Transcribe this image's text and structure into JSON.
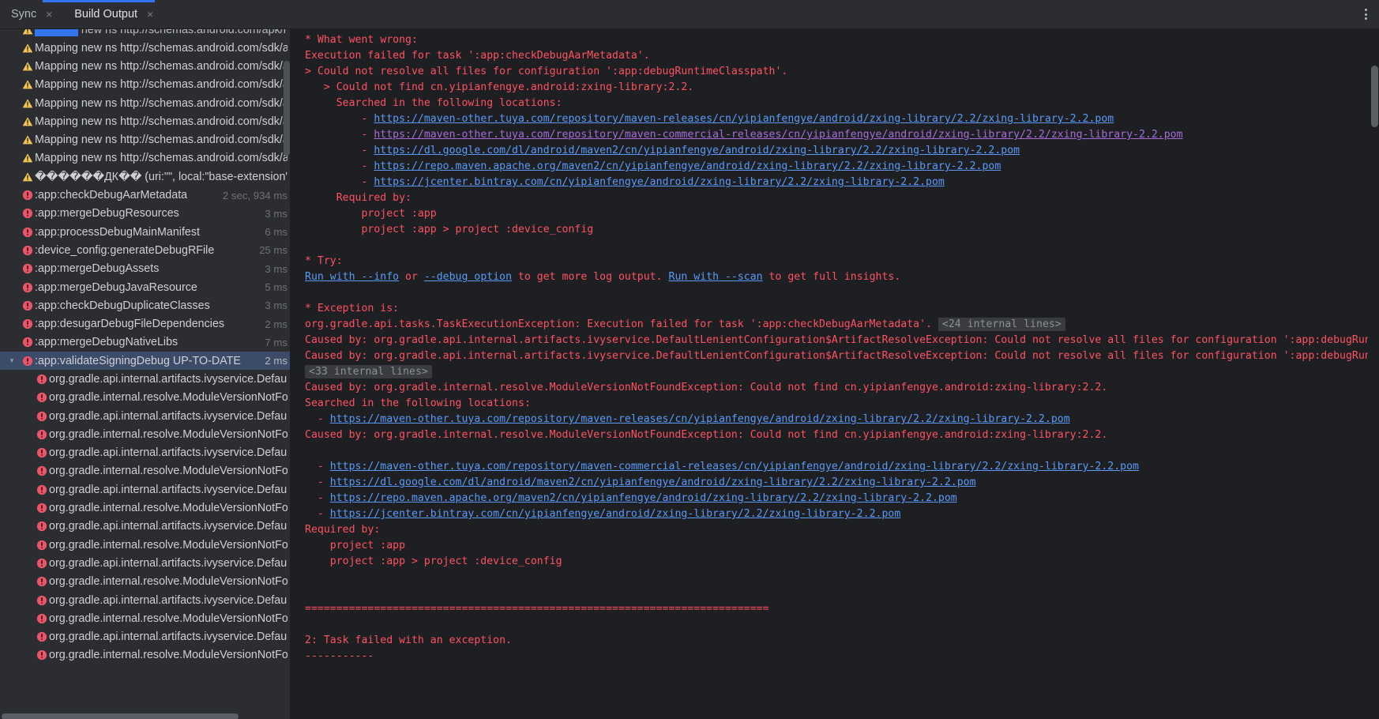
{
  "window": {
    "background": "#1e1f22",
    "tree_background": "#2b2d30",
    "accent": "#3574f0",
    "error_color": "#ff5261",
    "link_color": "#5a9bf8",
    "visited_link_color": "#a86cd8"
  },
  "tabs": {
    "items": [
      {
        "label": "Sync",
        "close": "×",
        "active": false
      },
      {
        "label": "Build Output",
        "close": "×",
        "active": true
      }
    ],
    "more_label": "more-options"
  },
  "tree": {
    "clipped_top_row": "Mapping new ns http://schemas.android.com/apk/res/android, ns http://schemas.android.com/repo",
    "items": [
      {
        "icon": "warning-icon",
        "label": "Mapping new ns http://schemas.android.com/sdk/a",
        "time": ""
      },
      {
        "icon": "warning-icon",
        "label": "Mapping new ns http://schemas.android.com/sdk/a",
        "time": ""
      },
      {
        "icon": "warning-icon",
        "label": "Mapping new ns http://schemas.android.com/sdk/a",
        "time": ""
      },
      {
        "icon": "warning-icon",
        "label": "Mapping new ns http://schemas.android.com/sdk/a",
        "time": ""
      },
      {
        "icon": "warning-icon",
        "label": "Mapping new ns http://schemas.android.com/sdk/a",
        "time": ""
      },
      {
        "icon": "warning-icon",
        "label": "Mapping new ns http://schemas.android.com/sdk/a",
        "time": ""
      },
      {
        "icon": "warning-icon",
        "label": "Mapping new ns http://schemas.android.com/sdk/a",
        "time": ""
      },
      {
        "icon": "warning-icon",
        "label": "������ДК�� (uri:\"\", local:\"base-extension\")��",
        "time": ""
      },
      {
        "icon": "error-icon",
        "label": ":app:checkDebugAarMetadata",
        "time": "2 sec, 934 ms"
      },
      {
        "icon": "error-icon",
        "label": ":app:mergeDebugResources",
        "time": "3 ms"
      },
      {
        "icon": "error-icon",
        "label": ":app:processDebugMainManifest",
        "time": "6 ms"
      },
      {
        "icon": "error-icon",
        "label": ":device_config:generateDebugRFile",
        "time": "25 ms"
      },
      {
        "icon": "error-icon",
        "label": ":app:mergeDebugAssets",
        "time": "3 ms"
      },
      {
        "icon": "error-icon",
        "label": ":app:mergeDebugJavaResource",
        "time": "5 ms"
      },
      {
        "icon": "error-icon",
        "label": ":app:checkDebugDuplicateClasses",
        "time": "3 ms"
      },
      {
        "icon": "error-icon",
        "label": ":app:desugarDebugFileDependencies",
        "time": "2 ms"
      },
      {
        "icon": "error-icon",
        "label": ":app:mergeDebugNativeLibs",
        "time": "7 ms"
      }
    ],
    "selected": {
      "icon": "error-icon",
      "chevron": "⌄",
      "label": ":app:validateSigningDebug UP-TO-DATE",
      "time": "2 ms"
    },
    "children": [
      {
        "icon": "error-icon",
        "label": "org.gradle.api.internal.artifacts.ivyservice.Defau"
      },
      {
        "icon": "error-icon",
        "label": "org.gradle.internal.resolve.ModuleVersionNotFo"
      },
      {
        "icon": "error-icon",
        "label": "org.gradle.api.internal.artifacts.ivyservice.Defau"
      },
      {
        "icon": "error-icon",
        "label": "org.gradle.internal.resolve.ModuleVersionNotFo"
      },
      {
        "icon": "error-icon",
        "label": "org.gradle.api.internal.artifacts.ivyservice.Defau"
      },
      {
        "icon": "error-icon",
        "label": "org.gradle.internal.resolve.ModuleVersionNotFo"
      },
      {
        "icon": "error-icon",
        "label": "org.gradle.api.internal.artifacts.ivyservice.Defau"
      },
      {
        "icon": "error-icon",
        "label": "org.gradle.internal.resolve.ModuleVersionNotFo"
      },
      {
        "icon": "error-icon",
        "label": "org.gradle.api.internal.artifacts.ivyservice.Defau"
      },
      {
        "icon": "error-icon",
        "label": "org.gradle.internal.resolve.ModuleVersionNotFo"
      },
      {
        "icon": "error-icon",
        "label": "org.gradle.api.internal.artifacts.ivyservice.Defau"
      },
      {
        "icon": "error-icon",
        "label": "org.gradle.internal.resolve.ModuleVersionNotFo"
      },
      {
        "icon": "error-icon",
        "label": "org.gradle.api.internal.artifacts.ivyservice.Defau"
      },
      {
        "icon": "error-icon",
        "label": "org.gradle.internal.resolve.ModuleVersionNotFo"
      },
      {
        "icon": "error-icon",
        "label": "org.gradle.api.internal.artifacts.ivyservice.Defau"
      },
      {
        "icon": "error-icon",
        "label": "org.gradle.internal.resolve.ModuleVersionNotFo"
      }
    ]
  },
  "console": {
    "lines": [
      {
        "t": "text",
        "c": "red",
        "v": "* What went wrong:"
      },
      {
        "t": "text",
        "c": "red",
        "v": "Execution failed for task ':app:checkDebugAarMetadata'."
      },
      {
        "t": "text",
        "c": "red",
        "v": "> Could not resolve all files for configuration ':app:debugRuntimeClasspath'."
      },
      {
        "t": "text",
        "c": "red",
        "v": "   > Could not find cn.yipianfengye.android:zxing-library:2.2."
      },
      {
        "t": "text",
        "c": "red",
        "v": "     Searched in the following locations:"
      },
      {
        "t": "link",
        "prefix": "         - ",
        "link": "https://maven-other.tuya.com/repository/maven-releases/cn/yipianfengye/android/zxing-library/2.2/zxing-library-2.2.pom",
        "visited": false
      },
      {
        "t": "link",
        "prefix": "         - ",
        "link": "https://maven-other.tuya.com/repository/maven-commercial-releases/cn/yipianfengye/android/zxing-library/2.2/zxing-library-2.2.pom",
        "visited": true
      },
      {
        "t": "link",
        "prefix": "         - ",
        "link": "https://dl.google.com/dl/android/maven2/cn/yipianfengye/android/zxing-library/2.2/zxing-library-2.2.pom",
        "visited": false
      },
      {
        "t": "link",
        "prefix": "         - ",
        "link": "https://repo.maven.apache.org/maven2/cn/yipianfengye/android/zxing-library/2.2/zxing-library-2.2.pom",
        "visited": false
      },
      {
        "t": "link",
        "prefix": "         - ",
        "link": "https://jcenter.bintray.com/cn/yipianfengye/android/zxing-library/2.2/zxing-library-2.2.pom",
        "visited": false
      },
      {
        "t": "text",
        "c": "red",
        "v": "     Required by:"
      },
      {
        "t": "text",
        "c": "red",
        "v": "         project :app"
      },
      {
        "t": "text",
        "c": "red",
        "v": "         project :app > project :device_config"
      },
      {
        "t": "text",
        "c": "red",
        "v": ""
      },
      {
        "t": "text",
        "c": "red",
        "v": "* Try:"
      },
      {
        "t": "try",
        "parts": [
          {
            "t": "link",
            "v": "Run with --info"
          },
          {
            "t": "red",
            "v": " or "
          },
          {
            "t": "link",
            "v": "--debug option"
          },
          {
            "t": "red",
            "v": " to get more log output. "
          },
          {
            "t": "link",
            "v": "Run with --scan"
          },
          {
            "t": "red",
            "v": " to get full insights."
          }
        ]
      },
      {
        "t": "text",
        "c": "red",
        "v": ""
      },
      {
        "t": "text",
        "c": "red",
        "v": "* Exception is:"
      },
      {
        "t": "fold",
        "caret": "›",
        "v": "org.gradle.api.tasks.TaskExecutionException: Execution failed for task ':app:checkDebugAarMetadata'. ",
        "badge": "<24 internal lines>"
      },
      {
        "t": "text",
        "c": "red",
        "caret": "›",
        "v": "Caused by: org.gradle.api.internal.artifacts.ivyservice.DefaultLenientConfiguration$ArtifactResolveException: Could not resolve all files for configuration ':app:debugRun"
      },
      {
        "t": "text",
        "c": "red",
        "v": "Caused by: org.gradle.api.internal.artifacts.ivyservice.DefaultLenientConfiguration$ArtifactResolveException: Could not resolve all files for configuration ':app:debugRun"
      },
      {
        "t": "badgeonly",
        "caret": "›",
        "badge": "<33 internal lines>"
      },
      {
        "t": "text",
        "c": "red",
        "v": "Caused by: org.gradle.internal.resolve.ModuleVersionNotFoundException: Could not find cn.yipianfengye.android:zxing-library:2.2."
      },
      {
        "t": "text",
        "c": "red",
        "v": "Searched in the following locations:"
      },
      {
        "t": "link",
        "prefix": "  - ",
        "link": "https://maven-other.tuya.com/repository/maven-releases/cn/yipianfengye/android/zxing-library/2.2/zxing-library-2.2.pom",
        "visited": false
      },
      {
        "t": "text",
        "c": "red",
        "v": "Caused by: org.gradle.internal.resolve.ModuleVersionNotFoundException: Could not find cn.yipianfengye.android:zxing-library:2.2."
      },
      {
        "t": "text",
        "c": "red",
        "v": ""
      },
      {
        "t": "link",
        "prefix": "  - ",
        "link": "https://maven-other.tuya.com/repository/maven-commercial-releases/cn/yipianfengye/android/zxing-library/2.2/zxing-library-2.2.pom",
        "visited": false
      },
      {
        "t": "link",
        "prefix": "  - ",
        "link": "https://dl.google.com/dl/android/maven2/cn/yipianfengye/android/zxing-library/2.2/zxing-library-2.2.pom",
        "visited": false
      },
      {
        "t": "link",
        "prefix": "  - ",
        "link": "https://repo.maven.apache.org/maven2/cn/yipianfengye/android/zxing-library/2.2/zxing-library-2.2.pom",
        "visited": false
      },
      {
        "t": "link",
        "prefix": "  - ",
        "link": "https://jcenter.bintray.com/cn/yipianfengye/android/zxing-library/2.2/zxing-library-2.2.pom",
        "visited": false
      },
      {
        "t": "text",
        "c": "red",
        "v": "Required by:"
      },
      {
        "t": "text",
        "c": "red",
        "v": "    project :app"
      },
      {
        "t": "text",
        "c": "red",
        "v": "    project :app > project :device_config"
      },
      {
        "t": "text",
        "c": "red",
        "v": ""
      },
      {
        "t": "text",
        "c": "red",
        "v": ""
      },
      {
        "t": "text",
        "c": "red",
        "v": "=========================================================================="
      },
      {
        "t": "text",
        "c": "red",
        "v": ""
      },
      {
        "t": "text",
        "c": "red",
        "v": "2: Task failed with an exception."
      },
      {
        "t": "text",
        "c": "red",
        "v": "-----------"
      }
    ]
  }
}
